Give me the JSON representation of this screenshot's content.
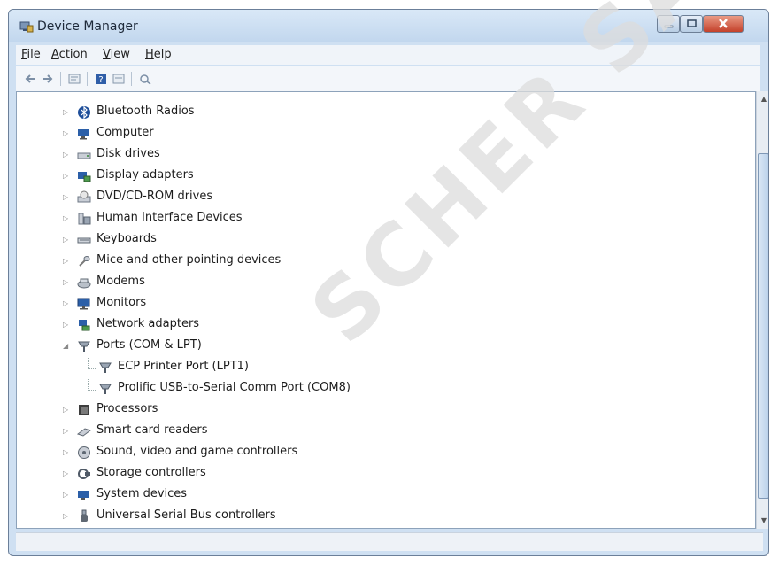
{
  "window": {
    "title": "Device Manager"
  },
  "menu": [
    "File",
    "Action",
    "View",
    "Help"
  ],
  "toolbar": [
    "back-icon",
    "forward-icon",
    "properties-icon",
    "help-icon",
    "scan-icon",
    "update-driver-icon"
  ],
  "tree": [
    {
      "label": "Bluetooth Radios",
      "icon": "bluetooth-icon",
      "expanded": false,
      "level": 0
    },
    {
      "label": "Computer",
      "icon": "computer-icon",
      "expanded": false,
      "level": 0
    },
    {
      "label": "Disk drives",
      "icon": "disk-drive-icon",
      "expanded": false,
      "level": 0
    },
    {
      "label": "Display adapters",
      "icon": "display-adapter-icon",
      "expanded": false,
      "level": 0
    },
    {
      "label": "DVD/CD-ROM drives",
      "icon": "optical-drive-icon",
      "expanded": false,
      "level": 0
    },
    {
      "label": "Human Interface Devices",
      "icon": "hid-icon",
      "expanded": false,
      "level": 0
    },
    {
      "label": "Keyboards",
      "icon": "keyboard-icon",
      "expanded": false,
      "level": 0
    },
    {
      "label": "Mice and other pointing devices",
      "icon": "mouse-icon",
      "expanded": false,
      "level": 0
    },
    {
      "label": "Modems",
      "icon": "modem-icon",
      "expanded": false,
      "level": 0
    },
    {
      "label": "Monitors",
      "icon": "monitor-icon",
      "expanded": false,
      "level": 0
    },
    {
      "label": "Network adapters",
      "icon": "network-adapter-icon",
      "expanded": false,
      "level": 0
    },
    {
      "label": "Ports (COM & LPT)",
      "icon": "port-icon",
      "expanded": true,
      "level": 0
    },
    {
      "label": "ECP Printer Port (LPT1)",
      "icon": "port-icon",
      "level": 1
    },
    {
      "label": "Prolific USB-to-Serial Comm Port (COM8)",
      "icon": "port-icon",
      "level": 1
    },
    {
      "label": "Processors",
      "icon": "processor-icon",
      "expanded": false,
      "level": 0
    },
    {
      "label": "Smart card readers",
      "icon": "smart-card-icon",
      "expanded": false,
      "level": 0
    },
    {
      "label": "Sound, video and game controllers",
      "icon": "sound-icon",
      "expanded": false,
      "level": 0
    },
    {
      "label": "Storage controllers",
      "icon": "storage-controller-icon",
      "expanded": false,
      "level": 0
    },
    {
      "label": "System devices",
      "icon": "system-devices-icon",
      "expanded": false,
      "level": 0
    },
    {
      "label": "Universal Serial Bus controllers",
      "icon": "usb-icon",
      "expanded": false,
      "level": 0
    }
  ],
  "watermark": "SCHER SA",
  "colors": {
    "title_bar": "#cfe0f2",
    "close_button": "#c4412a",
    "tree_background": "#ffffff",
    "watermark": "#dcdcdc"
  }
}
